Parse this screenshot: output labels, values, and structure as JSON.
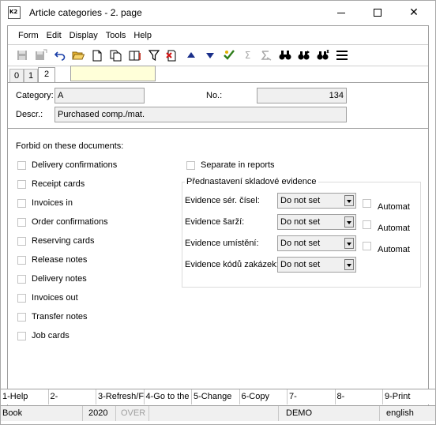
{
  "window": {
    "title": "Article categories - 2. page",
    "app_icon_text": "K2"
  },
  "menu": [
    "Form",
    "Edit",
    "Display",
    "Tools",
    "Help"
  ],
  "toolbar": {
    "icons": [
      "save-icon",
      "save-as-icon",
      "undo-icon",
      "open-folder-icon",
      "new-document-icon",
      "copy-icon",
      "book-icon",
      "filter-icon",
      "clear-filter-icon",
      "move-up-icon",
      "move-down-icon",
      "recalculate-icon",
      "sum-icon",
      "sum-disabled-icon",
      "find-icon",
      "find-next-icon",
      "find-replace-icon",
      "list-icon"
    ]
  },
  "tabs": [
    "0",
    "1",
    "2"
  ],
  "active_tab": "2",
  "form": {
    "category_label": "Category:",
    "category_value": "A",
    "no_label": "No.:",
    "no_value": "134",
    "descr_label": "Descr.:",
    "descr_value": "Purchased comp./mat."
  },
  "forbid": {
    "heading": "Forbid on these documents:",
    "items": [
      "Delivery confirmations",
      "Receipt cards",
      "Invoices in",
      "Order confirmations",
      "Reserving cards",
      "Release notes",
      "Delivery notes",
      "Invoices out",
      "Transfer notes",
      "Job cards"
    ],
    "separate_label": "Separate in reports"
  },
  "evidence": {
    "title": "Přednastavení skladové evidence",
    "rows": [
      {
        "label": "Evidence sér. čísel",
        "value": "Do not set",
        "automat": "Automat"
      },
      {
        "label": "Evidence šarží",
        "value": "Do not set",
        "automat": "Automat"
      },
      {
        "label": "Evidence umístění",
        "value": "Do not set",
        "automat": "Automat"
      },
      {
        "label": "Evidence kódů zakázek",
        "value": "Do not set"
      }
    ]
  },
  "fkeys": [
    "1-Help",
    "2-",
    "3-Refresh/F",
    "4-Go to the",
    "5-Change",
    "6-Copy",
    "7-",
    "8-",
    "9-Print"
  ],
  "status": {
    "book": "Book",
    "year": "2020",
    "mode": "OVER",
    "db": "DEMO",
    "lang": "english"
  }
}
